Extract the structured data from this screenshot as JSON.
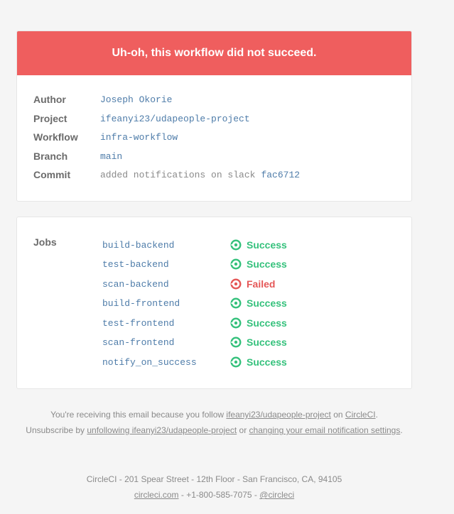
{
  "banner": {
    "title": "Uh-oh, this workflow did not succeed."
  },
  "meta": {
    "author_label": "Author",
    "author": "Joseph Okorie",
    "project_label": "Project",
    "project": "ifeanyi23/udapeople-project",
    "workflow_label": "Workflow",
    "workflow": "infra-workflow",
    "branch_label": "Branch",
    "branch": "main",
    "commit_label": "Commit",
    "commit_message": "added notifications on slack",
    "commit_hash": "fac6712"
  },
  "jobs": {
    "label": "Jobs",
    "items": [
      {
        "name": "build-backend",
        "status": "Success"
      },
      {
        "name": "test-backend",
        "status": "Success"
      },
      {
        "name": "scan-backend",
        "status": "Failed"
      },
      {
        "name": "build-frontend",
        "status": "Success"
      },
      {
        "name": "test-frontend",
        "status": "Success"
      },
      {
        "name": "scan-frontend",
        "status": "Success"
      },
      {
        "name": "notify_on_success",
        "status": "Success"
      }
    ]
  },
  "footer": {
    "line1_prefix": "You're receiving this email because you follow",
    "line1_link": "ifeanyi23/udapeople-project",
    "line1_mid": "on",
    "line1_link2": "CircleCI",
    "line1_end": ".",
    "line2_prefix": "Unsubscribe by",
    "line2_link1": "unfollowing ifeanyi23/udapeople-project",
    "line2_mid": "or",
    "line2_link2": "changing your email notification settings",
    "line2_end": ".",
    "address": "CircleCI - 201 Spear Street - 12th Floor - San Francisco, CA, 94105",
    "site_link": "circleci.com",
    "phone": "- +1-800-585-7075 -",
    "twitter_link": "@circleci"
  },
  "colors": {
    "banner": "#ef5e5e",
    "success": "#35c17c",
    "failed": "#e55757",
    "link": "#4e7ca9"
  },
  "icons": {
    "success": "check-circle-icon",
    "failed": "failed-circle-icon"
  }
}
